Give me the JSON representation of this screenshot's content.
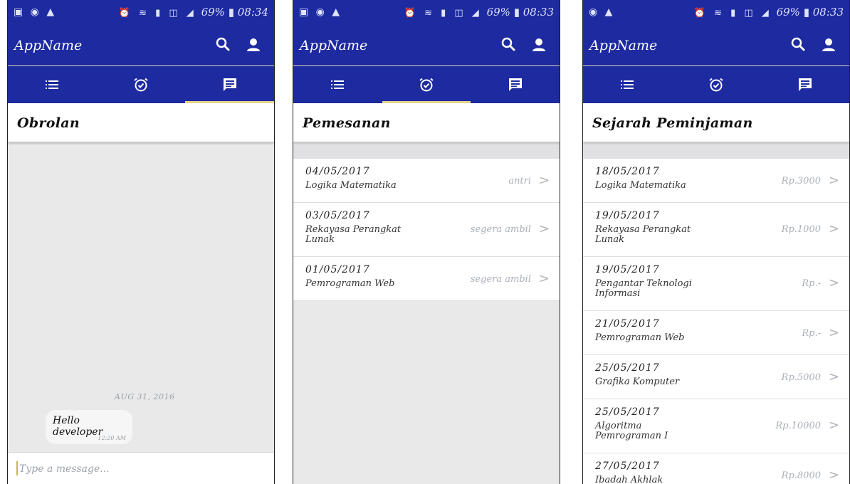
{
  "colors": {
    "primary": "#1d2aa0",
    "tab_indicator": "#e6d48a",
    "background": "#e9e9ea"
  },
  "screens": [
    {
      "status": {
        "battery": "69%",
        "time": "08:34"
      },
      "app_name": "AppName",
      "active_tab": 3,
      "header_title": "Obrolan",
      "chat": {
        "date": "AUG 31, 2016",
        "message": "Hello developer",
        "time": "12:20 AM",
        "placeholder": "Type a message..."
      }
    },
    {
      "status": {
        "battery": "69%",
        "time": "08:33"
      },
      "app_name": "AppName",
      "active_tab": 2,
      "header_title": "Pemesanan",
      "items": [
        {
          "date": "04/05/2017",
          "title": "Logika Matematika",
          "status": "antri"
        },
        {
          "date": "03/05/2017",
          "title": "Rekayasa Perangkat Lunak",
          "status": "segera ambil"
        },
        {
          "date": "01/05/2017",
          "title": "Pemrograman Web",
          "status": "segera ambil"
        }
      ]
    },
    {
      "status": {
        "battery": "69%",
        "time": "08:33"
      },
      "app_name": "AppName",
      "active_tab": 1,
      "header_title": "Sejarah Peminjaman",
      "items": [
        {
          "date": "18/05/2017",
          "title": "Logika Matematika",
          "status": "Rp.3000"
        },
        {
          "date": "19/05/2017",
          "title": "Rekayasa Perangkat Lunak",
          "status": "Rp.1000"
        },
        {
          "date": "19/05/2017",
          "title": "Pengantar Teknologi Informasi",
          "status": "Rp.-"
        },
        {
          "date": "21/05/2017",
          "title": "Pemrograman Web",
          "status": "Rp.-"
        },
        {
          "date": "25/05/2017",
          "title": "Grafika Komputer",
          "status": "Rp.5000"
        },
        {
          "date": "25/05/2017",
          "title": "Algoritma Pemrograman I",
          "status": "Rp.10000"
        },
        {
          "date": "27/05/2017",
          "title": "Ibadah Akhlak",
          "status": "Rp.8000"
        }
      ]
    }
  ]
}
